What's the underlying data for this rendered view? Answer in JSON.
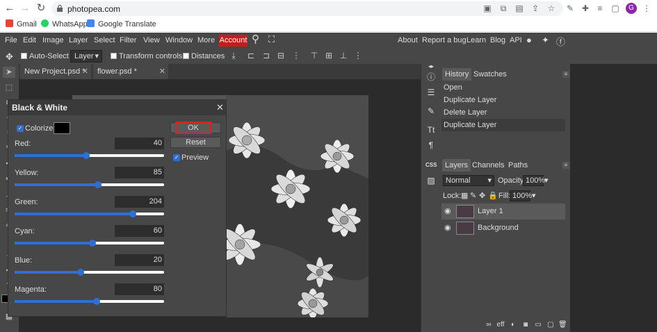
{
  "browser": {
    "url": "photopea.com",
    "bookmarks": [
      {
        "label": "Gmail",
        "color": "#ea4335"
      },
      {
        "label": "WhatsApp",
        "color": "#25d366"
      },
      {
        "label": "Google Translate",
        "color": "#4285f4"
      }
    ],
    "avatar_letter": "G"
  },
  "menubar": {
    "items": [
      "File",
      "Edit",
      "Image",
      "Layer",
      "Select",
      "Filter",
      "View",
      "Window",
      "More"
    ],
    "account": "Account",
    "right_links": [
      "About",
      "Report a bug",
      "Learn",
      "Blog",
      "API"
    ]
  },
  "toolopts": {
    "auto_select": "Auto-Select",
    "layer_select": "Layer",
    "transform_controls": "Transform controls",
    "distances": "Distances"
  },
  "tabs": [
    "New Project.psd *",
    "flower.psd *"
  ],
  "dialog": {
    "title": "Black & White",
    "colorize_label": "Colorize",
    "ok": "OK",
    "reset": "Reset",
    "preview": "Preview",
    "sliders": [
      {
        "label": "Red:",
        "value": "40",
        "level": 0.48
      },
      {
        "label": "Yellow:",
        "value": "85",
        "level": 0.56
      },
      {
        "label": "Green:",
        "value": "204",
        "level": 0.79
      },
      {
        "label": "Cyan:",
        "value": "60",
        "level": 0.52
      },
      {
        "label": "Blue:",
        "value": "20",
        "level": 0.44
      },
      {
        "label": "Magenta:",
        "value": "80",
        "level": 0.55
      }
    ]
  },
  "history": {
    "tabs": [
      "History",
      "Swatches"
    ],
    "items": [
      "Open",
      "Duplicate Layer",
      "Delete Layer",
      "Duplicate Layer"
    ]
  },
  "layers": {
    "tabs": [
      "Layers",
      "Channels",
      "Paths"
    ],
    "blend_mode": "Normal",
    "opacity_label": "Opacity:",
    "opacity": "100%",
    "lock_label": "Lock:",
    "fill_label": "Fill:",
    "fill": "100%",
    "items": [
      "Layer 1",
      "Background"
    ],
    "bottom_eff": "eff"
  },
  "colors": {
    "accent": "#2d6fd6",
    "account_red": "#cc1a1a",
    "highlight_red": "#e02020"
  }
}
